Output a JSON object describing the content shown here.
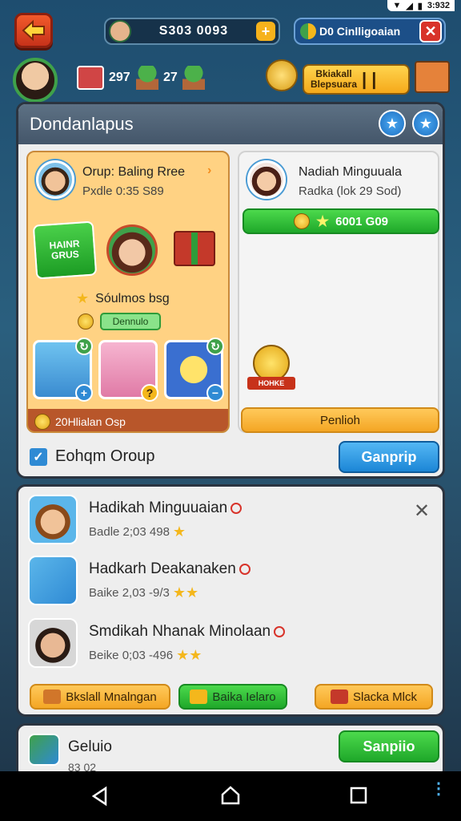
{
  "status": {
    "time": "3:932"
  },
  "topbar": {
    "currency_value": "S303 0093",
    "event_label": "D0 Cinlligoaian"
  },
  "stats": {
    "mail_count": "297",
    "plant_count": "27"
  },
  "offer": {
    "line1": "Bkiakall",
    "line2": "Blepsuara"
  },
  "main": {
    "title": "Dondanlapus",
    "group_card": {
      "title": "Orup: Baling Rree",
      "subtitle": "Pxdle 0:35 S89",
      "badge_text": "HAINR GRUS",
      "reward_label": "Sóulmos bsg",
      "tag_label": "Dennulo",
      "footer": "20Hlialan Osp"
    },
    "right_card": {
      "name": "Nadiah Minguuala",
      "subtitle": "Radka (lok 29 Sod)",
      "bar_text": "6001 G09",
      "medal_text": "HOHKE",
      "button": "Penlioh"
    },
    "checkbox_label": "Eohqm Oroup",
    "action_button": "Ganprip"
  },
  "list": {
    "items": [
      {
        "name": "Hadikah Minguuaian",
        "sub": "Badle 2;03 498"
      },
      {
        "name": "Hadkarh Deakanaken",
        "sub": "Baike 2,03 -9/3"
      },
      {
        "name": "Smdikah Nhanak Minolaan",
        "sub": "Beike 0;03 -496"
      }
    ],
    "buttons": [
      "Bkslall Mnalngan",
      "Baika Ielaro",
      "Slacka Mlck"
    ]
  },
  "bottom": {
    "title": "Geluio",
    "sub": "83 02",
    "button": "Sanpiio"
  },
  "colors": {
    "accent_green": "#1fa82a",
    "accent_blue": "#1c86d6",
    "accent_orange": "#f4a624",
    "header": "#44566a"
  }
}
